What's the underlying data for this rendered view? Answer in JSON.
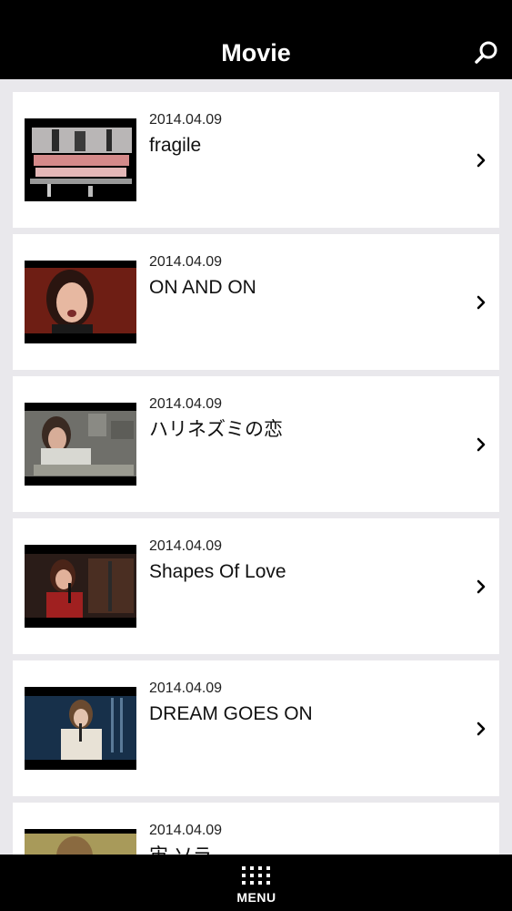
{
  "header": {
    "title": "Movie"
  },
  "icons": {
    "search": "search-icon",
    "chevron": "chevron-right-icon",
    "menu": "grid-menu-icon"
  },
  "movies": [
    {
      "date": "2014.04.09",
      "title": "fragile"
    },
    {
      "date": "2014.04.09",
      "title": "ON AND ON"
    },
    {
      "date": "2014.04.09",
      "title": "ハリネズミの恋"
    },
    {
      "date": "2014.04.09",
      "title": "Shapes Of Love"
    },
    {
      "date": "2014.04.09",
      "title": "DREAM GOES ON"
    },
    {
      "date": "2014.04.09",
      "title": "宙 ソラ"
    }
  ],
  "footer": {
    "menu_label": "MENU"
  }
}
